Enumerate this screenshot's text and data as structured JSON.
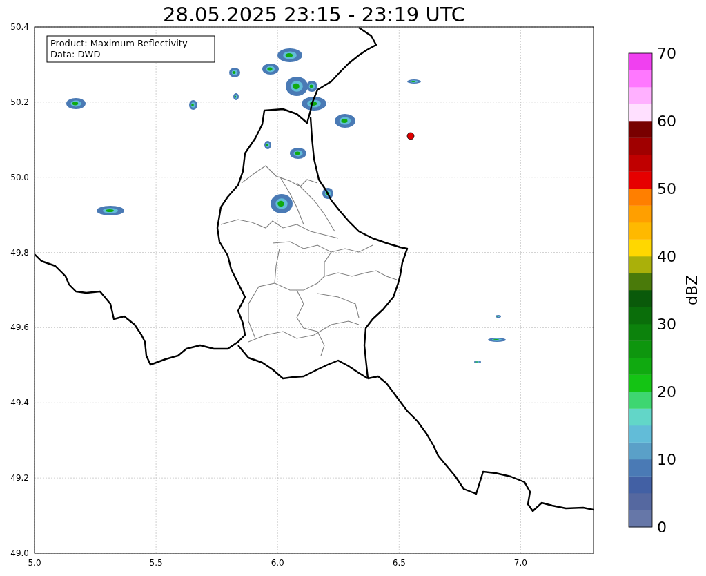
{
  "title": "28.05.2025 23:15 - 23:19 UTC",
  "info_box": {
    "lines": [
      "Product: Maximum Reflectivity",
      "Data: DWD"
    ]
  },
  "map": {
    "x_ticks": [
      "5.0",
      "5.5",
      "6.0",
      "6.5",
      "7.0"
    ],
    "y_ticks": [
      "50.4",
      "50.2",
      "50.0",
      "49.8",
      "49.6",
      "49.4",
      "49.2",
      "49.0"
    ]
  },
  "colorbar": {
    "label": "dBZ",
    "ticks": [
      "70",
      "60",
      "50",
      "40",
      "30",
      "20",
      "10",
      "0"
    ],
    "bands": [
      {
        "color": "#6677a8"
      },
      {
        "color": "#5568a0"
      },
      {
        "color": "#4260a4"
      },
      {
        "color": "#4a7ab5"
      },
      {
        "color": "#5aa0c8"
      },
      {
        "color": "#62bcd8"
      },
      {
        "color": "#62d6c8"
      },
      {
        "color": "#3ed671"
      },
      {
        "color": "#14c414"
      },
      {
        "color": "#10aa10"
      },
      {
        "color": "#0e960e"
      },
      {
        "color": "#0c820c"
      },
      {
        "color": "#0a6e0a"
      },
      {
        "color": "#0a5a0a"
      },
      {
        "color": "#4a7a0a"
      },
      {
        "color": "#aab00a"
      },
      {
        "color": "#ffd700"
      },
      {
        "color": "#ffb900"
      },
      {
        "color": "#ff9f00"
      },
      {
        "color": "#ff7f00"
      },
      {
        "color": "#e60000"
      },
      {
        "color": "#c00000"
      },
      {
        "color": "#a00000"
      },
      {
        "color": "#780000"
      },
      {
        "color": "#ffe0ff"
      },
      {
        "color": "#ffb0ff"
      },
      {
        "color": "#ff78ff"
      },
      {
        "color": "#f040f0"
      }
    ]
  }
}
